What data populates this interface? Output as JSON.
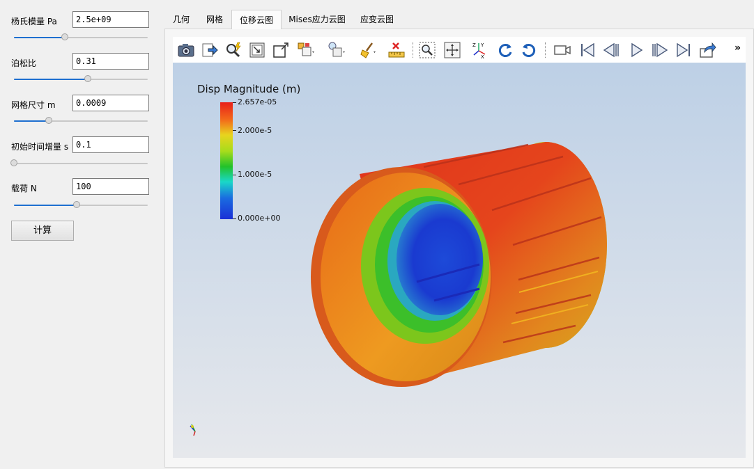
{
  "params": [
    {
      "label": "杨氏模量 Pa",
      "value": "2.5e+09",
      "slider": 0.38
    },
    {
      "label": "泊松比",
      "value": "0.31",
      "slider": 0.55
    },
    {
      "label": "网格尺寸 m",
      "value": "0.0009",
      "slider": 0.26
    },
    {
      "label": "初始时间增量 s",
      "value": "0.1",
      "slider": 0.0
    },
    {
      "label": "载荷 N",
      "value": "100",
      "slider": 0.47
    }
  ],
  "calc_button": "计算",
  "tabs": [
    "几何",
    "网格",
    "位移云图",
    "Mises应力云图",
    "应变云图"
  ],
  "active_tab": "位移云图",
  "toolbar_icons": [
    "camera-icon",
    "export-icon",
    "zoom-to-data-icon",
    "reset-camera-closest-icon",
    "zoom-to-box-icon",
    "select-block-icon",
    "view-options-icon",
    "clear-icon",
    "remove-measure-icon",
    "zoom-selection-icon",
    "center-icon",
    "axes-orientation-icon",
    "rotate-cw-icon",
    "rotate-ccw-icon",
    "record-camera-icon",
    "first-frame-icon",
    "previous-frame-icon",
    "play-icon",
    "next-frame-icon",
    "last-frame-icon",
    "share-icon"
  ],
  "toolbar_overflow": "»",
  "legend": {
    "title": "Disp Magnitude (m)",
    "labels": [
      "2.657e-05",
      "2.000e-5",
      "1.000e-5",
      "0.000e+00"
    ]
  },
  "colors": {
    "accent": "#1e6fd0",
    "max": "#e8201a",
    "min": "#1a2fd6"
  }
}
